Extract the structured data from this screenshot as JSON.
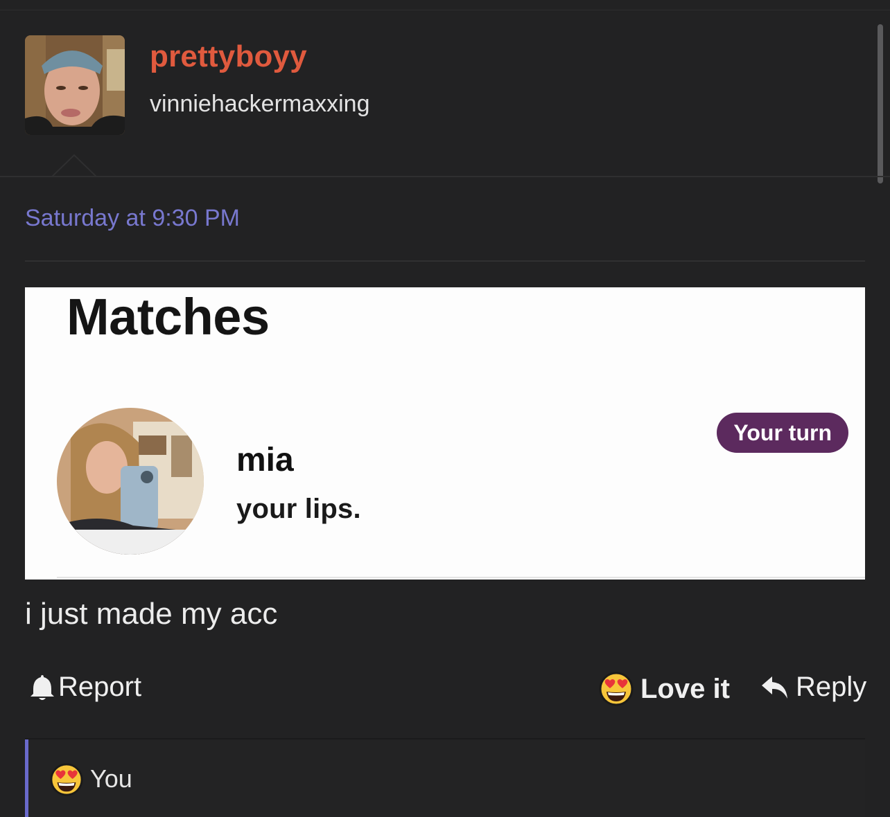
{
  "post": {
    "author": {
      "username": "prettyboyy",
      "title": "vinniehackermaxxing"
    },
    "timestamp": "Saturday at 9:30 PM",
    "embedded_screenshot": {
      "heading": "Matches",
      "match_name": "mia",
      "match_message": "your lips.",
      "badge": "Your turn"
    },
    "body_text": "i just made my acc",
    "actions": {
      "report_label": "Report",
      "love_label": "Love it",
      "reply_label": "Reply"
    },
    "reactions": {
      "user_label": "You",
      "icon": "heart-eyes-emoji-icon"
    }
  },
  "colors": {
    "background": "#222223",
    "username": "#e05a3e",
    "timestamp": "#7878cf",
    "badge": "#5c2a5e",
    "reaction_bar": "#6a6acb"
  }
}
